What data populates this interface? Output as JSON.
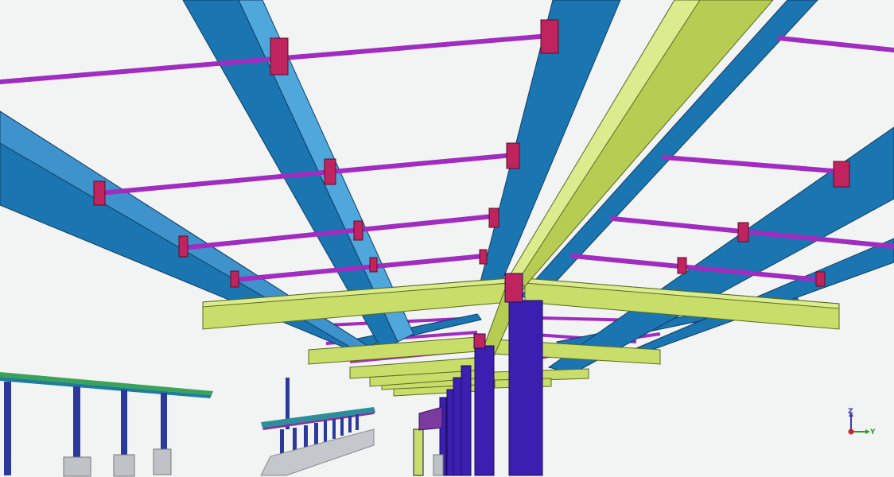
{
  "viewport": {
    "background": "#f2f3f3"
  },
  "colors": {
    "column": "#3a1fb0",
    "beam_blue": "#1b75b0",
    "beam_yellow": "#c9dd6a",
    "purlin": "#a02cc0",
    "connection_plate": "#c0245e"
  },
  "axis_triad": {
    "z_label": "Z",
    "y_label": "Y",
    "icons": [
      "z-axis-arrow-icon",
      "y-axis-arrow-icon",
      "origin-icon"
    ]
  }
}
